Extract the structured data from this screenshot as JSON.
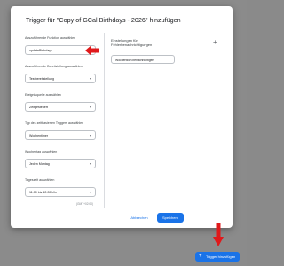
{
  "dialog": {
    "title": "Trigger für \"Copy of GCal Birthdays - 2026\" hinzufügen",
    "fields": [
      {
        "label": "Auszuführende Funktion auswählen",
        "value": "updateBirthdays"
      },
      {
        "label": "Auszuführende Bereitstellung auswählen",
        "value": "Testbereitstellung"
      },
      {
        "label": "Ereignisquelle auswählen",
        "value": "Zeitgesteuert"
      },
      {
        "label": "Typ des zeitbasierten Triggers auswählen",
        "value": "Wochentimer"
      },
      {
        "label": "Wochentag auswählen",
        "value": "Jeden Montag"
      },
      {
        "label": "Tageszeit auswählen",
        "value": "11:00 bis 12:00 Uhr"
      }
    ],
    "dst_hint": "(GMT+02:00)",
    "notifications": {
      "label_line1": "Einstellungen für",
      "label_line2": "Fehlerbenachrichtigungen",
      "chip": "Wöchentlich benachrichtigen"
    },
    "buttons": {
      "cancel": "Abbrechen",
      "save": "Speichern"
    }
  },
  "fab": {
    "label": "Trigger hinzufügen"
  },
  "icons": {
    "chevron": "chevron-down-icon",
    "plus": "plus-icon",
    "arrow_color": "#e0191b"
  },
  "colors": {
    "accent": "#1a73e8",
    "overlay": "#8b8b8b"
  }
}
